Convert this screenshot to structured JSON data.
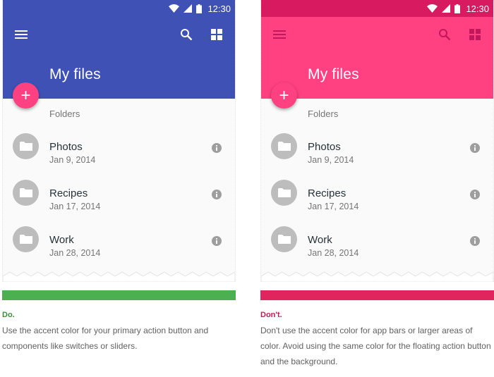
{
  "colors": {
    "good_status": "#3f51b5",
    "good_bar": "#3f51b5",
    "good_fab": "#ff4081",
    "good_accent_bar": "#4caf50",
    "good_verdict": "#388e3c",
    "bad_status": "#d81b60",
    "bad_bar": "#ff4081",
    "bad_fab": "#ff4081",
    "bad_accent_bar": "#e0245e",
    "bad_verdict": "#c2185b"
  },
  "panels": [
    {
      "status_time": "12:30",
      "title": "My files",
      "fab_label": "+",
      "folders_label": "Folders",
      "items": [
        {
          "name": "Photos",
          "date": "Jan 9, 2014"
        },
        {
          "name": "Recipes",
          "date": "Jan 17, 2014"
        },
        {
          "name": "Work",
          "date": "Jan 28, 2014"
        }
      ],
      "verdict": "Do.",
      "description": "Use the accent color for your primary action button and components like switches or sliders."
    },
    {
      "status_time": "12:30",
      "title": "My files",
      "fab_label": "+",
      "folders_label": "Folders",
      "items": [
        {
          "name": "Photos",
          "date": "Jan 9, 2014"
        },
        {
          "name": "Recipes",
          "date": "Jan 17, 2014"
        },
        {
          "name": "Work",
          "date": "Jan 28, 2014"
        }
      ],
      "verdict": "Don't.",
      "description": "Don't use the accent color for app bars or larger areas of color. Avoid using the same color for the floating action button and the background."
    }
  ],
  "icons": [
    "wifi-icon",
    "signal-icon",
    "battery-icon",
    "menu-icon",
    "search-icon",
    "grid-view-icon",
    "add-icon",
    "folder-icon",
    "info-icon"
  ]
}
